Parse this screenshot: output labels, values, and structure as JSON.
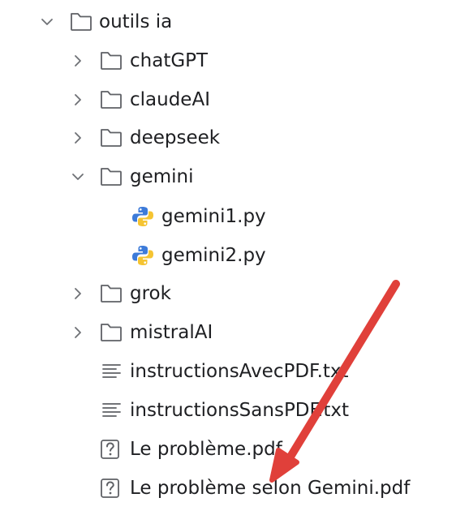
{
  "tree": {
    "root": {
      "label": "outils ia",
      "expanded": true,
      "icon": "folder-icon"
    },
    "items": [
      {
        "label": "chatGPT",
        "type": "folder",
        "expanded": false,
        "icon": "folder-icon"
      },
      {
        "label": "claudeAI",
        "type": "folder",
        "expanded": false,
        "icon": "folder-icon"
      },
      {
        "label": "deepseek",
        "type": "folder",
        "expanded": false,
        "icon": "folder-icon"
      },
      {
        "label": "gemini",
        "type": "folder",
        "expanded": true,
        "icon": "folder-icon",
        "children": [
          {
            "label": "gemini1.py",
            "type": "python-file",
            "icon": "python-icon"
          },
          {
            "label": "gemini2.py",
            "type": "python-file",
            "icon": "python-icon"
          }
        ]
      },
      {
        "label": "grok",
        "type": "folder",
        "expanded": false,
        "icon": "folder-icon"
      },
      {
        "label": "mistralAI",
        "type": "folder",
        "expanded": false,
        "icon": "folder-icon"
      },
      {
        "label": "instructionsAvecPDF.txt",
        "type": "text-file",
        "icon": "text-file-icon"
      },
      {
        "label": "instructionsSansPDF.txt",
        "type": "text-file",
        "icon": "text-file-icon"
      },
      {
        "label": "Le problème.pdf",
        "type": "unknown-file",
        "icon": "unknown-file-icon"
      },
      {
        "label": "Le problème selon Gemini.pdf",
        "type": "unknown-file",
        "icon": "unknown-file-icon"
      }
    ]
  },
  "annotation": {
    "icon": "red-arrow-icon",
    "color": "#e0403a"
  },
  "colors": {
    "folder_stroke": "#5f6166",
    "python_blue": "#3d7bd9",
    "python_yellow": "#f5c432",
    "text": "#1e1f22"
  }
}
